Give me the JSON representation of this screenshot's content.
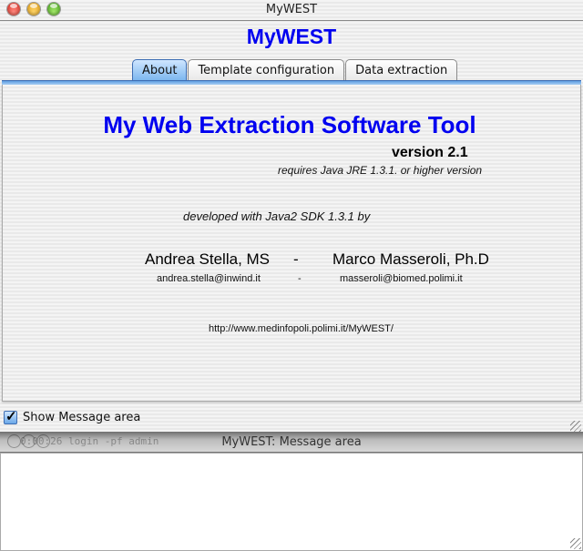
{
  "window": {
    "title": "MyWEST",
    "controls": [
      "close-button",
      "minimize-button",
      "zoom-button"
    ]
  },
  "app_title": "MyWEST",
  "tabs": [
    {
      "label": "About",
      "active": true
    },
    {
      "label": "Template configuration",
      "active": false
    },
    {
      "label": "Data extraction",
      "active": false
    }
  ],
  "about": {
    "title": "My Web Extraction Software Tool",
    "version": "version 2.1",
    "requires": "requires Java JRE 1.3.1. or higher version",
    "developed": "developed with Java2 SDK 1.3.1 by",
    "author1": "Andrea Stella, MS",
    "separator": "-",
    "author2": "Marco Masseroli, Ph.D",
    "email1": "andrea.stella@inwind.it",
    "email2": "masseroli@biomed.polimi.it",
    "url": "http://www.medinfopoli.polimi.it/MyWEST/"
  },
  "show_message_area": {
    "label": "Show Message area",
    "checked": true
  },
  "message_window": {
    "title": "MyWEST: Message area",
    "background_text": "0:00:26 login -pf admin",
    "content": ""
  },
  "colors": {
    "accent": "#0000f0",
    "tab_active": "#7db7ef"
  }
}
